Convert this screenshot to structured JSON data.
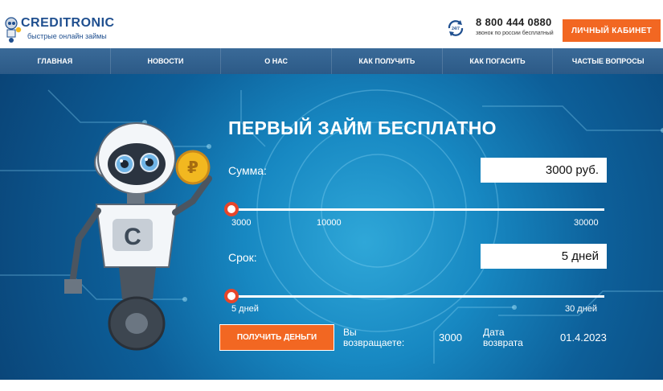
{
  "header": {
    "logo_title": "CREDITRONIC",
    "logo_subtitle": "быстрые онлайн займы",
    "support_badge": "24/7",
    "phone": "8 800 444 0880",
    "phone_note": "звонок по россии бесплатный",
    "cabinet_label": "ЛИЧНЫЙ КАБИНЕТ"
  },
  "nav": {
    "items": [
      {
        "label": "ГЛАВНАЯ"
      },
      {
        "label": "НОВОСТИ"
      },
      {
        "label": "О НАС"
      },
      {
        "label": "КАК ПОЛУЧИТЬ"
      },
      {
        "label": "КАК ПОГАСИТЬ"
      },
      {
        "label": "ЧАСТЫЕ ВОПРОСЫ"
      }
    ]
  },
  "hero": {
    "title": "ПЕРВЫЙ ЗАЙМ БЕСПЛАТНО",
    "robot_chest_letter": "C",
    "coin_symbol": "₽",
    "amount": {
      "label": "Сумма:",
      "value": "3000 руб.",
      "ticks": [
        "3000",
        "10000",
        "30000"
      ],
      "position": 0
    },
    "term": {
      "label": "Срок:",
      "value": "5 дней",
      "ticks": [
        "5 дней",
        "30 дней"
      ],
      "position": 0
    },
    "get_button": "ПОЛУЧИТЬ ДЕНЬГИ",
    "return_label": "Вы возвращаете:",
    "return_value": "3000",
    "date_label": "Дата возврата",
    "date_value": "01.4.2023"
  },
  "colors": {
    "accent": "#f26722",
    "nav": "#2c5a87",
    "hero": "#1788c2",
    "slider_handle": "#e8452a",
    "logo": "#1f4f8f"
  }
}
